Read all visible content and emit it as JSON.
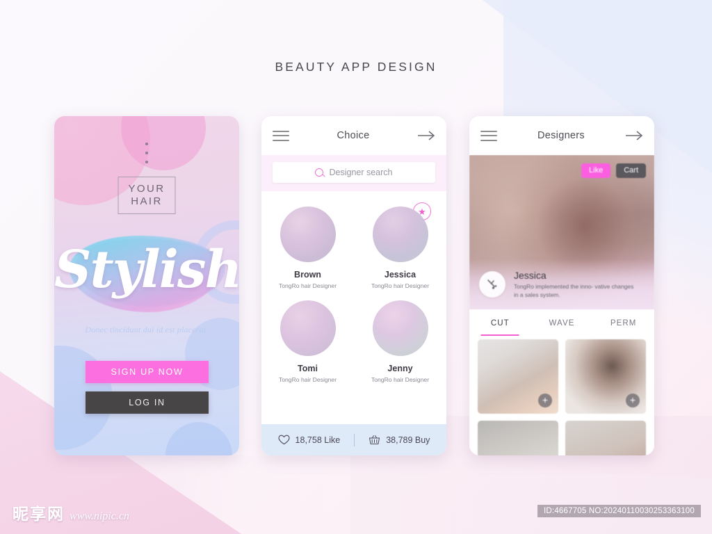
{
  "page": {
    "title": "BEAUTY APP DESIGN"
  },
  "splash": {
    "logo_line1": "YOUR",
    "logo_line2": "HAIR",
    "script_word": "Stylish",
    "tagline": "Donec tincidunt dui id est placerat.",
    "signup_label": "SIGN UP NOW",
    "login_label": "LOG IN",
    "colors": {
      "primary": "#fb6fe0",
      "dark": "#474545"
    }
  },
  "choice": {
    "appbar_title": "Choice",
    "search_placeholder": "Designer search",
    "designers": [
      {
        "name": "Brown",
        "role": "TongRo hair Designer",
        "starred": false
      },
      {
        "name": "Jessica",
        "role": "TongRo hair Designer",
        "starred": true
      },
      {
        "name": "Tomi",
        "role": "TongRo hair Designer",
        "starred": false
      },
      {
        "name": "Jenny",
        "role": "TongRo hair Designer",
        "starred": false
      }
    ],
    "footer": {
      "like_count": "18,758 Like",
      "buy_count": "38,789 Buy"
    }
  },
  "designers_screen": {
    "appbar_title": "Designers",
    "like_label": "Like",
    "cart_label": "Cart",
    "profile_name": "Jessica",
    "profile_desc": "TongRo implemented the inno- vative changes in a sales system.",
    "tabs": [
      {
        "label": "CUT",
        "active": true
      },
      {
        "label": "WAVE",
        "active": false
      },
      {
        "label": "PERM",
        "active": false
      }
    ],
    "add_label": "+"
  },
  "watermark": {
    "site_cn": "昵享网",
    "site_url": "www.nipic.cn",
    "id_text": "ID:4667705 NO:20240110030253363100"
  }
}
